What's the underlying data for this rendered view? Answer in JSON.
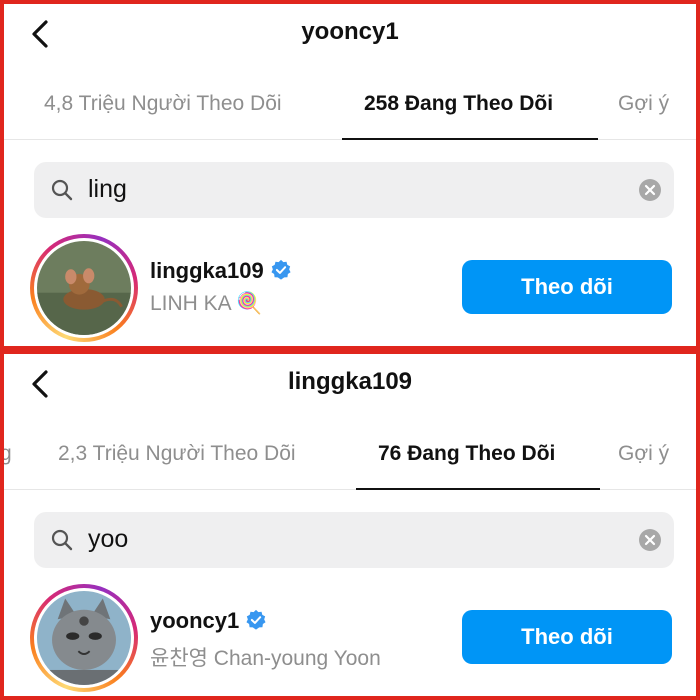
{
  "panels": [
    {
      "header": {
        "title": "yooncy1"
      },
      "tabs": [
        {
          "label": "4,8 Triệu Người Theo Dõi",
          "active": false
        },
        {
          "label": "258 Đang Theo Dõi",
          "active": true
        },
        {
          "label": "Gợi ý",
          "active": false
        }
      ],
      "search": {
        "query": "ling"
      },
      "result": {
        "username": "linggka109",
        "full_name": "LINH KA 🍭",
        "follow_label": "Theo dõi"
      }
    },
    {
      "header": {
        "title": "linggka109"
      },
      "tabs": [
        {
          "label": "g",
          "active": false
        },
        {
          "label": "2,3 Triệu Người Theo Dõi",
          "active": false
        },
        {
          "label": "76 Đang Theo Dõi",
          "active": true
        },
        {
          "label": "Gợi ý",
          "active": false
        }
      ],
      "search": {
        "query": "yoo"
      },
      "result": {
        "username": "yooncy1",
        "full_name": "윤찬영 Chan-young Yoon",
        "follow_label": "Theo dõi"
      }
    }
  ],
  "colors": {
    "frame": "#e0261d",
    "button": "#0095f6",
    "verified": "#3897f0"
  }
}
